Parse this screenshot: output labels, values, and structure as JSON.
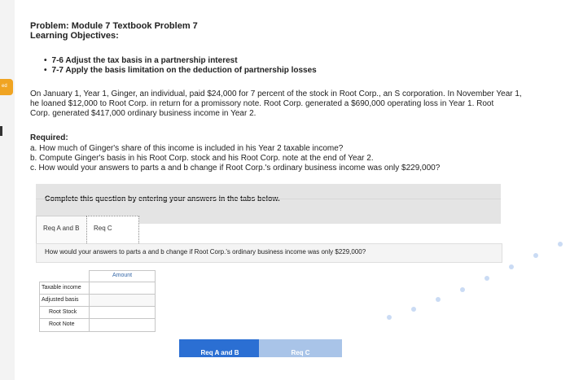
{
  "sidebar": {
    "tab_label": "ed"
  },
  "problem": {
    "title": "Problem: Module 7 Textbook Problem 7",
    "objectives_title": "Learning Objectives:",
    "objectives": [
      "7-6 Adjust the tax basis in a partnership interest",
      "7-7 Apply the basis limitation on the deduction of partnership losses"
    ],
    "paragraph_lines": [
      "On January 1, Year 1, Ginger, an individual, paid $24,000 for 7 percent of the stock in Root Corp., an S corporation. In November Year 1,",
      "he loaned $12,000 to Root Corp. in return for a promissory note. Root Corp. generated a $690,000 operating loss in Year 1. Root",
      "Corp. generated $417,000 ordinary business income in Year 2."
    ],
    "required_title": "Required:",
    "required_items": [
      "a. How much of Ginger's share of this income is included in his Year 2 taxable income?",
      "b. Compute Ginger's basis in his Root Corp. stock and his Root Corp. note at the end of Year 2.",
      "c. How would your answers to parts a and b change if Root Corp.'s ordinary business income was only $229,000?"
    ]
  },
  "instructions": "Complete this question by entering your answers in the tabs below.",
  "tabs": [
    {
      "label": "Req A and B"
    },
    {
      "label": "Req C"
    }
  ],
  "active_question": "How would your answers to parts a and b change if Root Corp.'s ordinary business income was only $229,000?",
  "answer_table": {
    "column_header": "Amount",
    "rows": [
      {
        "label": "Taxable income",
        "value": ""
      },
      {
        "label": "Adjusted basis",
        "value": ""
      },
      {
        "label": "Root Stock",
        "value": ""
      },
      {
        "label": "Root Note",
        "value": ""
      }
    ]
  },
  "nav": {
    "prev_label": "Req A and B",
    "next_label": "Req C",
    "prev_icon": "chevron-left-icon",
    "next_icon": "chevron-right-icon"
  },
  "colors": {
    "accent": "#2b6fd3",
    "disabled": "#a9c4e8",
    "tab_marker": "#f0a422"
  }
}
